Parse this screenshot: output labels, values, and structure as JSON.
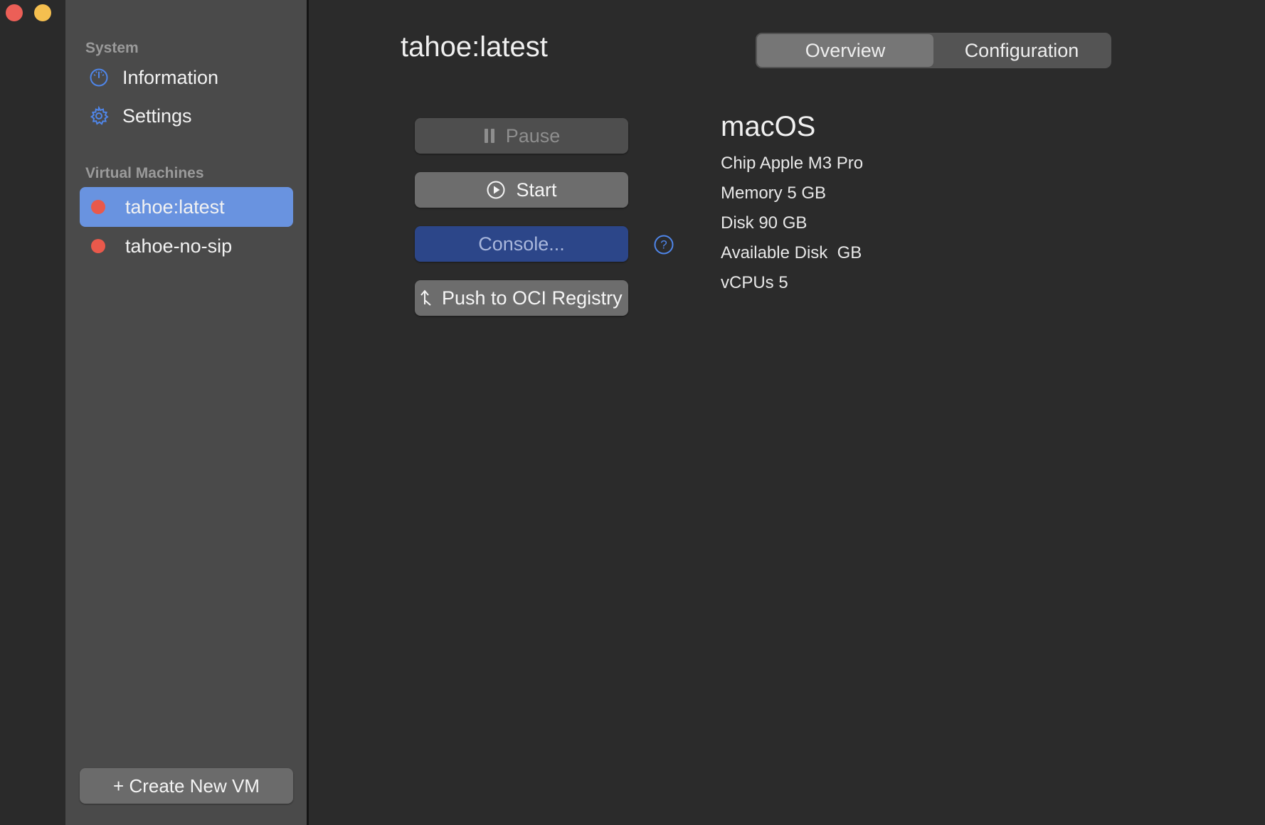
{
  "sidebar": {
    "system_header": "System",
    "system_items": [
      {
        "label": "Information",
        "icon": "gauge-icon"
      },
      {
        "label": "Settings",
        "icon": "gear-icon"
      }
    ],
    "vm_header": "Virtual Machines",
    "vms": [
      {
        "label": "tahoe:latest",
        "status_color": "#e9594b",
        "selected": true
      },
      {
        "label": "tahoe-no-sip",
        "status_color": "#e9594b",
        "selected": false
      }
    ],
    "create_label": "+ Create New VM"
  },
  "main": {
    "title": "tahoe:latest",
    "tabs": [
      {
        "label": "Overview",
        "active": true
      },
      {
        "label": "Configuration",
        "active": false
      }
    ],
    "actions": {
      "pause_label": "Pause",
      "start_label": "Start",
      "console_label": "Console...",
      "push_label": "Push to OCI Registry"
    },
    "os_name": "macOS",
    "specs": {
      "chip": "Chip Apple M3 Pro",
      "memory": "Memory 5 GB",
      "disk": "Disk 90 GB",
      "available_disk": "Available Disk  GB",
      "vcpus": "vCPUs 5"
    }
  },
  "colors": {
    "accent": "#6993e0",
    "console_button": "#2c4689",
    "status_stopped": "#e9594b",
    "close": "#ec5f57",
    "minimize": "#f5bf4f"
  }
}
